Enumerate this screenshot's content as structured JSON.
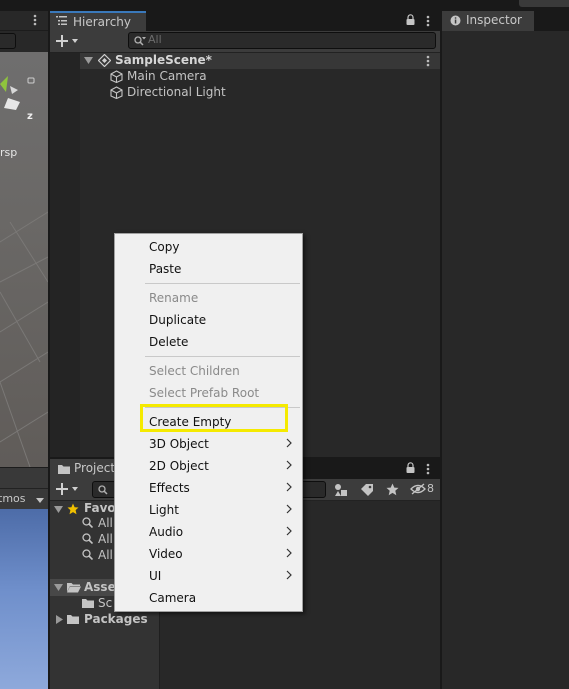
{
  "scene_panel": {
    "perspective_label": "rsp",
    "axis_label": "z",
    "gizmos_label": "tmos"
  },
  "hierarchy": {
    "tab_title": "Hierarchy",
    "search_placeholder": "All",
    "scene_name": "SampleScene*",
    "items": [
      {
        "label": "Main Camera"
      },
      {
        "label": "Directional Light"
      }
    ]
  },
  "inspector": {
    "tab_title": "Inspector"
  },
  "project": {
    "tab_title": "Project",
    "hidden_count": "8",
    "favorites_label": "Favo",
    "favorite_items": [
      {
        "label": "All"
      },
      {
        "label": "All"
      },
      {
        "label": "All"
      }
    ],
    "assets_label": "Asse",
    "assets_child": "Sc",
    "packages_label": "Packages"
  },
  "context_menu": {
    "items": [
      {
        "label": "Copy",
        "disabled": false,
        "submenu": false
      },
      {
        "label": "Paste",
        "disabled": false,
        "submenu": false
      },
      {
        "label": "Rename",
        "disabled": true,
        "submenu": false
      },
      {
        "label": "Duplicate",
        "disabled": false,
        "submenu": false
      },
      {
        "label": "Delete",
        "disabled": false,
        "submenu": false
      },
      {
        "label": "Select Children",
        "disabled": true,
        "submenu": false
      },
      {
        "label": "Select Prefab Root",
        "disabled": true,
        "submenu": false
      },
      {
        "label": "Create Empty",
        "disabled": false,
        "submenu": false,
        "highlighted": true
      },
      {
        "label": "3D Object",
        "disabled": false,
        "submenu": true
      },
      {
        "label": "2D Object",
        "disabled": false,
        "submenu": true
      },
      {
        "label": "Effects",
        "disabled": false,
        "submenu": true
      },
      {
        "label": "Light",
        "disabled": false,
        "submenu": true
      },
      {
        "label": "Audio",
        "disabled": false,
        "submenu": true
      },
      {
        "label": "Video",
        "disabled": false,
        "submenu": true
      },
      {
        "label": "UI",
        "disabled": false,
        "submenu": true
      },
      {
        "label": "Camera",
        "disabled": false,
        "submenu": false
      }
    ]
  },
  "colors": {
    "highlight": "#f5ea00",
    "active_tab_accent": "#3a79bb",
    "favorites_star": "#f0c000"
  }
}
